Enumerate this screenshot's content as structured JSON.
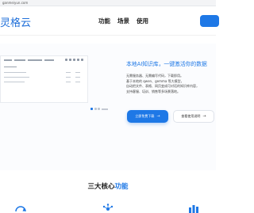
{
  "browser": {
    "url": "ganmeiyun.com"
  },
  "nav": {
    "logo": "灵格云",
    "items": [
      "功能",
      "场景",
      "使用"
    ]
  },
  "hero": {
    "title": "本地AI知识库，一键激活你的数据",
    "description": [
      "无需服务器、无需编写代码，下载即用。",
      "基于本地的 qwen、gemma 等大模型，",
      "自动把文件、表格、网页变成可对话的知识库内容，",
      "支持客服、培训、销售等多场景落地。"
    ],
    "primary_button": "立即免费下载",
    "secondary_button": "查看使用说明"
  },
  "features": {
    "title_prefix": "三大核心",
    "title_highlight": "功能",
    "icons": [
      "refresh-icon",
      "network-icon",
      "bar-chart-icon"
    ]
  },
  "colors": {
    "accent": "#1e78e6"
  }
}
